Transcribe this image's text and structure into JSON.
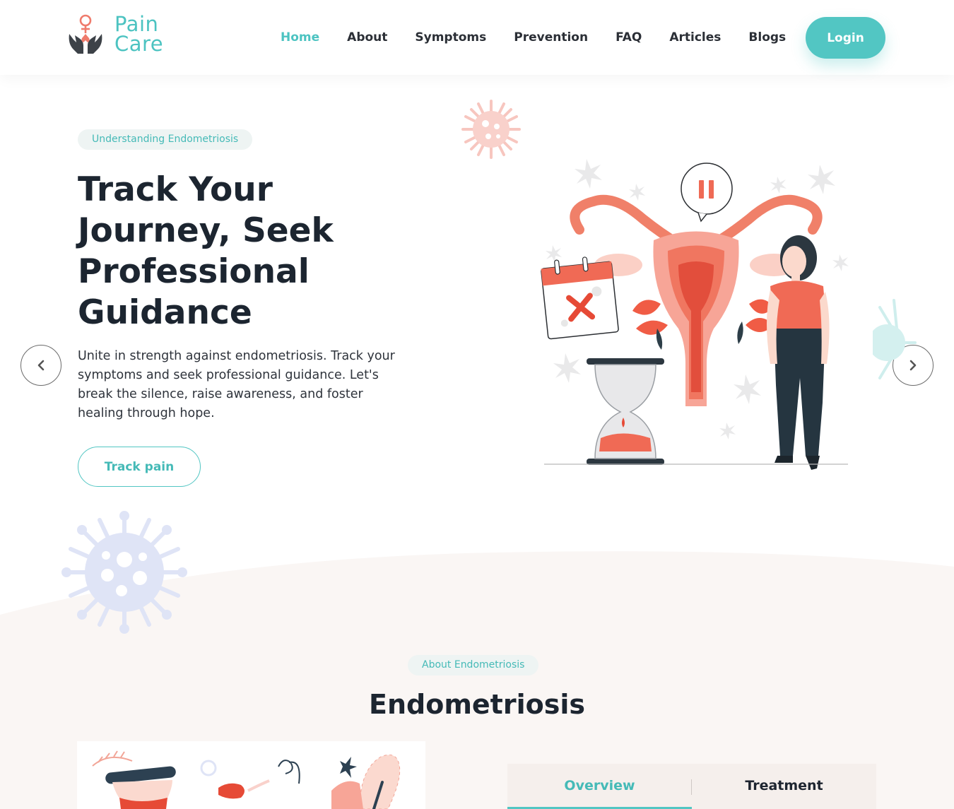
{
  "brand": {
    "line1": "Pain",
    "line2": "Care",
    "accent_color": "#52c6c3",
    "logo_icon": "hands-female-symbol-icon"
  },
  "nav": {
    "links": [
      {
        "label": "Home",
        "active": true
      },
      {
        "label": "About"
      },
      {
        "label": "Symptoms"
      },
      {
        "label": "Prevention"
      },
      {
        "label": "FAQ"
      },
      {
        "label": "Articles"
      },
      {
        "label": "Blogs"
      }
    ],
    "login_label": "Login"
  },
  "hero": {
    "eyebrow": "Understanding Endometriosis",
    "title": "Track Your Journey, Seek Professional Guidance",
    "description": "Unite in strength against endometriosis. Track your symptoms and seek professional guidance. Let's break the silence, raise awareness, and foster healing through hope.",
    "cta_label": "Track pain",
    "prev_icon": "chevron-left-icon",
    "next_icon": "chevron-right-icon"
  },
  "about": {
    "eyebrow": "About Endometriosis",
    "title": "Endometriosis",
    "tabs": [
      {
        "label": "Overview",
        "active": true
      },
      {
        "label": "Treatment"
      }
    ]
  }
}
